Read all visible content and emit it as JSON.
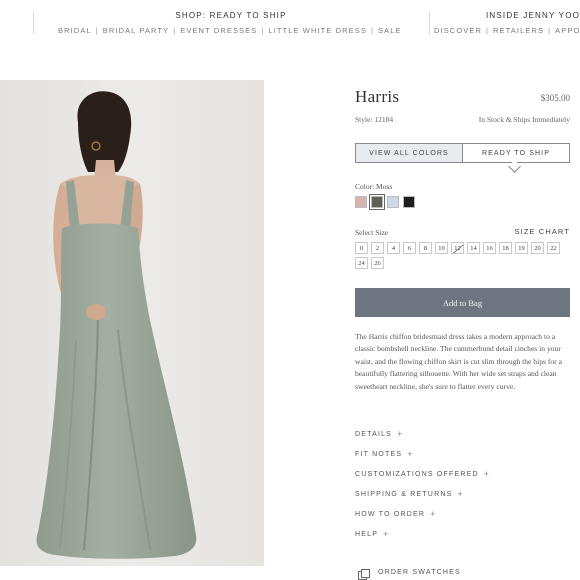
{
  "nav": {
    "shop_title": "SHOP: READY TO SHIP",
    "shop_links": [
      "BRIDAL",
      "BRIDAL PARTY",
      "EVENT DRESSES",
      "LITTLE WHITE DRESS",
      "SALE"
    ],
    "inside_title": "INSIDE JENNY YOO",
    "inside_links": [
      "DISCOVER",
      "RETAILERS",
      "APPOU"
    ]
  },
  "product": {
    "title": "Harris",
    "price": "$305.00",
    "style": "Style: 12184",
    "stock": "In Stock & Ships Immediately",
    "tabs": [
      "VIEW ALL COLORS",
      "READY TO SHIP"
    ],
    "color_label": "Color: Moss",
    "swatches": [
      {
        "name": "blush",
        "color": "#d8b4ae",
        "selected": false
      },
      {
        "name": "moss",
        "color": "#5d6257",
        "selected": true
      },
      {
        "name": "light-blue",
        "color": "#cdd9e8",
        "selected": false
      },
      {
        "name": "black",
        "color": "#1e1e1e",
        "selected": false
      }
    ],
    "size_label": "Select Size",
    "size_chart": "SIZE CHART",
    "sizes": [
      {
        "label": "0",
        "out": false
      },
      {
        "label": "2",
        "out": false
      },
      {
        "label": "4",
        "out": false
      },
      {
        "label": "6",
        "out": false
      },
      {
        "label": "8",
        "out": false
      },
      {
        "label": "10",
        "out": false
      },
      {
        "label": "12",
        "out": true
      },
      {
        "label": "14",
        "out": false
      },
      {
        "label": "16",
        "out": false
      },
      {
        "label": "18",
        "out": false
      },
      {
        "label": "19",
        "out": false
      },
      {
        "label": "20",
        "out": false
      },
      {
        "label": "22",
        "out": false
      },
      {
        "label": "24",
        "out": false
      },
      {
        "label": "26",
        "out": false
      }
    ],
    "add_to_bag": "Add to Bag",
    "description": "The Harris chiffon bridesmaid dress takes a modern approach to a classic bombshell neckline. The cummerbund detail cinches in your waist, and the flowing chiffon skirt is cut slim through the hips for a beautifully flattering silhouette. With her wide set straps and clean sweetheart neckline, she's sure to flatter every curve.",
    "accordion": [
      "DETAILS",
      "FIT NOTES",
      "CUSTOMIZATIONS OFFERED",
      "SHIPPING & RETURNS",
      "HOW TO ORDER",
      "HELP"
    ],
    "plus_symbol": "+",
    "order_swatches": "ORDER SWATCHES"
  },
  "colors": {
    "button_bg": "#6d7680",
    "dress": "#9aa69a",
    "photo_bg": "#e9e6e3"
  }
}
